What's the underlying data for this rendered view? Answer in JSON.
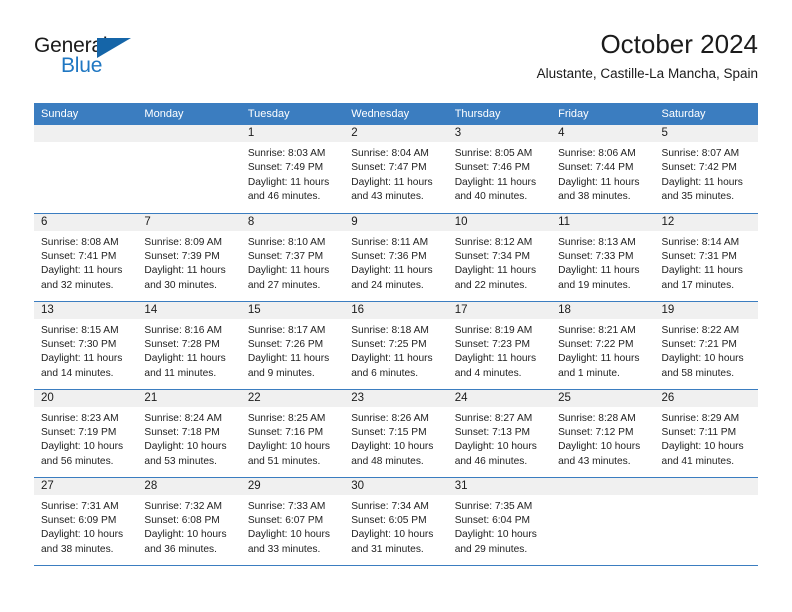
{
  "brand": {
    "name_part1": "General",
    "name_part2": "Blue",
    "color_dark": "#1b1b1b",
    "color_blue": "#1f77c2",
    "triangle_color": "#1565a8"
  },
  "header": {
    "title": "October 2024",
    "subtitle": "Alustante, Castille-La Mancha, Spain"
  },
  "theme": {
    "header_row_bg": "#3b7dc0",
    "header_row_text": "#ffffff",
    "daynum_strip_bg": "#f0f0f0",
    "row_separator": "#3b7dc0",
    "body_text": "#222222"
  },
  "weekdays": [
    "Sunday",
    "Monday",
    "Tuesday",
    "Wednesday",
    "Thursday",
    "Friday",
    "Saturday"
  ],
  "weeks": [
    [
      {
        "day": "",
        "empty": true,
        "line1": "",
        "line2": "",
        "line3": "",
        "line4": ""
      },
      {
        "day": "",
        "empty": true,
        "line1": "",
        "line2": "",
        "line3": "",
        "line4": ""
      },
      {
        "day": "1",
        "empty": false,
        "line1": "Sunrise: 8:03 AM",
        "line2": "Sunset: 7:49 PM",
        "line3": "Daylight: 11 hours",
        "line4": "and 46 minutes."
      },
      {
        "day": "2",
        "empty": false,
        "line1": "Sunrise: 8:04 AM",
        "line2": "Sunset: 7:47 PM",
        "line3": "Daylight: 11 hours",
        "line4": "and 43 minutes."
      },
      {
        "day": "3",
        "empty": false,
        "line1": "Sunrise: 8:05 AM",
        "line2": "Sunset: 7:46 PM",
        "line3": "Daylight: 11 hours",
        "line4": "and 40 minutes."
      },
      {
        "day": "4",
        "empty": false,
        "line1": "Sunrise: 8:06 AM",
        "line2": "Sunset: 7:44 PM",
        "line3": "Daylight: 11 hours",
        "line4": "and 38 minutes."
      },
      {
        "day": "5",
        "empty": false,
        "line1": "Sunrise: 8:07 AM",
        "line2": "Sunset: 7:42 PM",
        "line3": "Daylight: 11 hours",
        "line4": "and 35 minutes."
      }
    ],
    [
      {
        "day": "6",
        "empty": false,
        "line1": "Sunrise: 8:08 AM",
        "line2": "Sunset: 7:41 PM",
        "line3": "Daylight: 11 hours",
        "line4": "and 32 minutes."
      },
      {
        "day": "7",
        "empty": false,
        "line1": "Sunrise: 8:09 AM",
        "line2": "Sunset: 7:39 PM",
        "line3": "Daylight: 11 hours",
        "line4": "and 30 minutes."
      },
      {
        "day": "8",
        "empty": false,
        "line1": "Sunrise: 8:10 AM",
        "line2": "Sunset: 7:37 PM",
        "line3": "Daylight: 11 hours",
        "line4": "and 27 minutes."
      },
      {
        "day": "9",
        "empty": false,
        "line1": "Sunrise: 8:11 AM",
        "line2": "Sunset: 7:36 PM",
        "line3": "Daylight: 11 hours",
        "line4": "and 24 minutes."
      },
      {
        "day": "10",
        "empty": false,
        "line1": "Sunrise: 8:12 AM",
        "line2": "Sunset: 7:34 PM",
        "line3": "Daylight: 11 hours",
        "line4": "and 22 minutes."
      },
      {
        "day": "11",
        "empty": false,
        "line1": "Sunrise: 8:13 AM",
        "line2": "Sunset: 7:33 PM",
        "line3": "Daylight: 11 hours",
        "line4": "and 19 minutes."
      },
      {
        "day": "12",
        "empty": false,
        "line1": "Sunrise: 8:14 AM",
        "line2": "Sunset: 7:31 PM",
        "line3": "Daylight: 11 hours",
        "line4": "and 17 minutes."
      }
    ],
    [
      {
        "day": "13",
        "empty": false,
        "line1": "Sunrise: 8:15 AM",
        "line2": "Sunset: 7:30 PM",
        "line3": "Daylight: 11 hours",
        "line4": "and 14 minutes."
      },
      {
        "day": "14",
        "empty": false,
        "line1": "Sunrise: 8:16 AM",
        "line2": "Sunset: 7:28 PM",
        "line3": "Daylight: 11 hours",
        "line4": "and 11 minutes."
      },
      {
        "day": "15",
        "empty": false,
        "line1": "Sunrise: 8:17 AM",
        "line2": "Sunset: 7:26 PM",
        "line3": "Daylight: 11 hours",
        "line4": "and 9 minutes."
      },
      {
        "day": "16",
        "empty": false,
        "line1": "Sunrise: 8:18 AM",
        "line2": "Sunset: 7:25 PM",
        "line3": "Daylight: 11 hours",
        "line4": "and 6 minutes."
      },
      {
        "day": "17",
        "empty": false,
        "line1": "Sunrise: 8:19 AM",
        "line2": "Sunset: 7:23 PM",
        "line3": "Daylight: 11 hours",
        "line4": "and 4 minutes."
      },
      {
        "day": "18",
        "empty": false,
        "line1": "Sunrise: 8:21 AM",
        "line2": "Sunset: 7:22 PM",
        "line3": "Daylight: 11 hours",
        "line4": "and 1 minute."
      },
      {
        "day": "19",
        "empty": false,
        "line1": "Sunrise: 8:22 AM",
        "line2": "Sunset: 7:21 PM",
        "line3": "Daylight: 10 hours",
        "line4": "and 58 minutes."
      }
    ],
    [
      {
        "day": "20",
        "empty": false,
        "line1": "Sunrise: 8:23 AM",
        "line2": "Sunset: 7:19 PM",
        "line3": "Daylight: 10 hours",
        "line4": "and 56 minutes."
      },
      {
        "day": "21",
        "empty": false,
        "line1": "Sunrise: 8:24 AM",
        "line2": "Sunset: 7:18 PM",
        "line3": "Daylight: 10 hours",
        "line4": "and 53 minutes."
      },
      {
        "day": "22",
        "empty": false,
        "line1": "Sunrise: 8:25 AM",
        "line2": "Sunset: 7:16 PM",
        "line3": "Daylight: 10 hours",
        "line4": "and 51 minutes."
      },
      {
        "day": "23",
        "empty": false,
        "line1": "Sunrise: 8:26 AM",
        "line2": "Sunset: 7:15 PM",
        "line3": "Daylight: 10 hours",
        "line4": "and 48 minutes."
      },
      {
        "day": "24",
        "empty": false,
        "line1": "Sunrise: 8:27 AM",
        "line2": "Sunset: 7:13 PM",
        "line3": "Daylight: 10 hours",
        "line4": "and 46 minutes."
      },
      {
        "day": "25",
        "empty": false,
        "line1": "Sunrise: 8:28 AM",
        "line2": "Sunset: 7:12 PM",
        "line3": "Daylight: 10 hours",
        "line4": "and 43 minutes."
      },
      {
        "day": "26",
        "empty": false,
        "line1": "Sunrise: 8:29 AM",
        "line2": "Sunset: 7:11 PM",
        "line3": "Daylight: 10 hours",
        "line4": "and 41 minutes."
      }
    ],
    [
      {
        "day": "27",
        "empty": false,
        "line1": "Sunrise: 7:31 AM",
        "line2": "Sunset: 6:09 PM",
        "line3": "Daylight: 10 hours",
        "line4": "and 38 minutes."
      },
      {
        "day": "28",
        "empty": false,
        "line1": "Sunrise: 7:32 AM",
        "line2": "Sunset: 6:08 PM",
        "line3": "Daylight: 10 hours",
        "line4": "and 36 minutes."
      },
      {
        "day": "29",
        "empty": false,
        "line1": "Sunrise: 7:33 AM",
        "line2": "Sunset: 6:07 PM",
        "line3": "Daylight: 10 hours",
        "line4": "and 33 minutes."
      },
      {
        "day": "30",
        "empty": false,
        "line1": "Sunrise: 7:34 AM",
        "line2": "Sunset: 6:05 PM",
        "line3": "Daylight: 10 hours",
        "line4": "and 31 minutes."
      },
      {
        "day": "31",
        "empty": false,
        "line1": "Sunrise: 7:35 AM",
        "line2": "Sunset: 6:04 PM",
        "line3": "Daylight: 10 hours",
        "line4": "and 29 minutes."
      },
      {
        "day": "",
        "empty": true,
        "line1": "",
        "line2": "",
        "line3": "",
        "line4": ""
      },
      {
        "day": "",
        "empty": true,
        "line1": "",
        "line2": "",
        "line3": "",
        "line4": ""
      }
    ]
  ]
}
